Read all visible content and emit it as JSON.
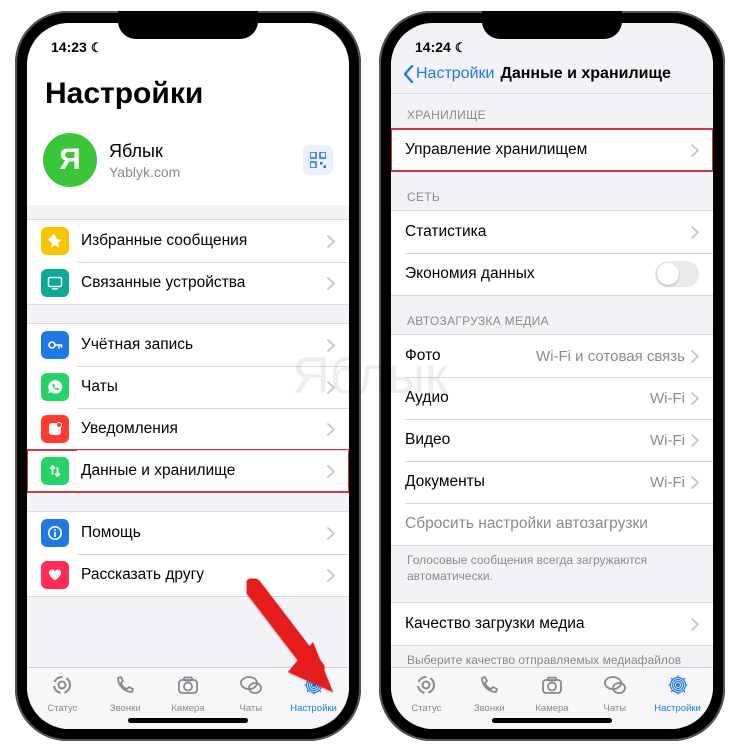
{
  "watermark": "Яблык",
  "left": {
    "status": {
      "time": "14:23"
    },
    "title": "Настройки",
    "profile": {
      "initial": "Я",
      "name": "Яблык",
      "subtitle": "Yablyk.com"
    },
    "groups": [
      {
        "cells": [
          {
            "key": "starred",
            "icon": "star",
            "color": "#f7c600",
            "label": "Избранные сообщения"
          },
          {
            "key": "linked",
            "icon": "monitor",
            "color": "#0ea89a",
            "label": "Связанные устройства"
          }
        ]
      },
      {
        "cells": [
          {
            "key": "account",
            "icon": "key",
            "color": "#1f78e5",
            "label": "Учётная запись"
          },
          {
            "key": "chats",
            "icon": "wa",
            "color": "#25d366",
            "label": "Чаты"
          },
          {
            "key": "notif",
            "icon": "bell",
            "color": "#ff3b30",
            "label": "Уведомления"
          },
          {
            "key": "data",
            "icon": "updown",
            "color": "#25d366",
            "label": "Данные и хранилище",
            "highlight": true
          }
        ]
      },
      {
        "cells": [
          {
            "key": "help",
            "icon": "info",
            "color": "#1f78e5",
            "label": "Помощь"
          },
          {
            "key": "tell",
            "icon": "heart",
            "color": "#ff2d55",
            "label": "Рассказать другу"
          }
        ]
      }
    ]
  },
  "right": {
    "status": {
      "time": "14:24"
    },
    "back_label": "Настройки",
    "title": "Данные и хранилище",
    "sections": [
      {
        "header": "ХРАНИЛИЩЕ",
        "cells": [
          {
            "key": "manage",
            "label": "Управление хранилищем",
            "type": "nav",
            "highlight": true
          }
        ]
      },
      {
        "header": "СЕТЬ",
        "cells": [
          {
            "key": "stats",
            "label": "Статистика",
            "type": "nav"
          },
          {
            "key": "saver",
            "label": "Экономия данных",
            "type": "toggle",
            "on": false
          }
        ]
      },
      {
        "header": "АВТОЗАГРУЗКА МЕДИА",
        "cells": [
          {
            "key": "photo",
            "label": "Фото",
            "value": "Wi-Fi и сотовая связь",
            "type": "nav"
          },
          {
            "key": "audio",
            "label": "Аудио",
            "value": "Wi-Fi",
            "type": "nav"
          },
          {
            "key": "video",
            "label": "Видео",
            "value": "Wi-Fi",
            "type": "nav"
          },
          {
            "key": "docs",
            "label": "Документы",
            "value": "Wi-Fi",
            "type": "nav"
          },
          {
            "key": "reset",
            "label": "Сбросить настройки автозагрузки",
            "type": "plain"
          }
        ],
        "footer": "Голосовые сообщения всегда загружаются автоматически."
      },
      {
        "cells": [
          {
            "key": "quality",
            "label": "Качество загрузки медиа",
            "type": "nav"
          }
        ],
        "footer": "Выберите качество отправляемых медиафайлов"
      }
    ]
  },
  "tabs": [
    {
      "key": "status",
      "label": "Статус",
      "icon": "status"
    },
    {
      "key": "calls",
      "label": "Звонки",
      "icon": "phone"
    },
    {
      "key": "camera",
      "label": "Камера",
      "icon": "camera"
    },
    {
      "key": "chats",
      "label": "Чаты",
      "icon": "bubbles"
    },
    {
      "key": "settings",
      "label": "Настройки",
      "icon": "gear",
      "active": true
    }
  ]
}
